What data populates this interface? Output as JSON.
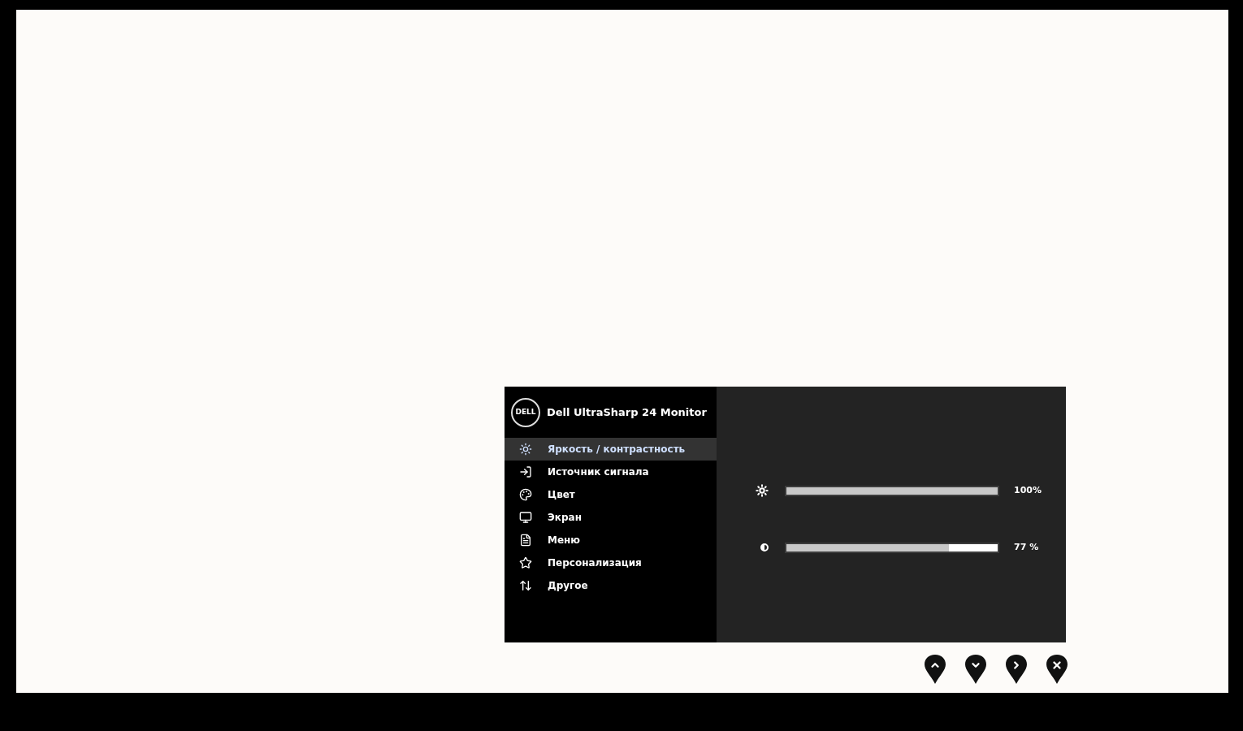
{
  "osd": {
    "logo_text": "DELL",
    "title": "Dell UltraSharp 24 Monitor",
    "menu_items": [
      {
        "label": "Яркость / контрастность",
        "selected": true
      },
      {
        "label": "Источник сигнала",
        "selected": false
      },
      {
        "label": "Цвет",
        "selected": false
      },
      {
        "label": "Экран",
        "selected": false
      },
      {
        "label": "Меню",
        "selected": false
      },
      {
        "label": "Персонализация",
        "selected": false
      },
      {
        "label": "Другое",
        "selected": false
      }
    ],
    "sliders": [
      {
        "kind": "brightness",
        "level": 1.0,
        "reading": "100%"
      },
      {
        "kind": "contrast",
        "level": 0.77,
        "reading": "77 %"
      }
    ]
  }
}
